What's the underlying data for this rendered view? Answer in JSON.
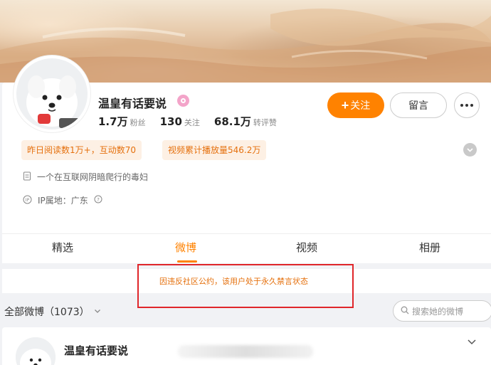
{
  "profile": {
    "name": "温皇有话要说",
    "stats": [
      {
        "num": "1.7万",
        "label": "粉丝"
      },
      {
        "num": "130",
        "label": "关注"
      },
      {
        "num": "68.1万",
        "label": "转评赞"
      }
    ],
    "follow_label": "关注",
    "follow_plus": "+",
    "message_label": "留言",
    "tags": [
      "昨日阅读数1万+，互动数70",
      "视频累计播放量546.2万"
    ],
    "description": "一个在互联网阴暗爬行的毒妇",
    "ip_location": "IP属地：广东"
  },
  "tabs": [
    {
      "label": "精选",
      "active": false
    },
    {
      "label": "微博",
      "active": true
    },
    {
      "label": "视频",
      "active": false
    },
    {
      "label": "相册",
      "active": false
    }
  ],
  "notice": "因违反社区公约，该用户处于永久禁言状态",
  "feed": {
    "filter_label": "全部微博（1073）",
    "search_placeholder": "搜索她的微博"
  },
  "post": {
    "author": "温皇有话要说"
  },
  "colors": {
    "accent": "#ff8200",
    "notice_text": "#e5700d",
    "highlight_box": "#e0262a",
    "verified_badge": "#f3a4c9"
  },
  "icons": {
    "badge": "verified-badge-icon",
    "more": "more-dots-icon",
    "expand": "chevron-down-circle-icon",
    "description": "document-icon",
    "ip": "ip-icon",
    "info": "help-circle-icon",
    "filter_chevron": "chevron-down-icon",
    "search": "search-icon",
    "post_menu": "chevron-down-icon"
  }
}
